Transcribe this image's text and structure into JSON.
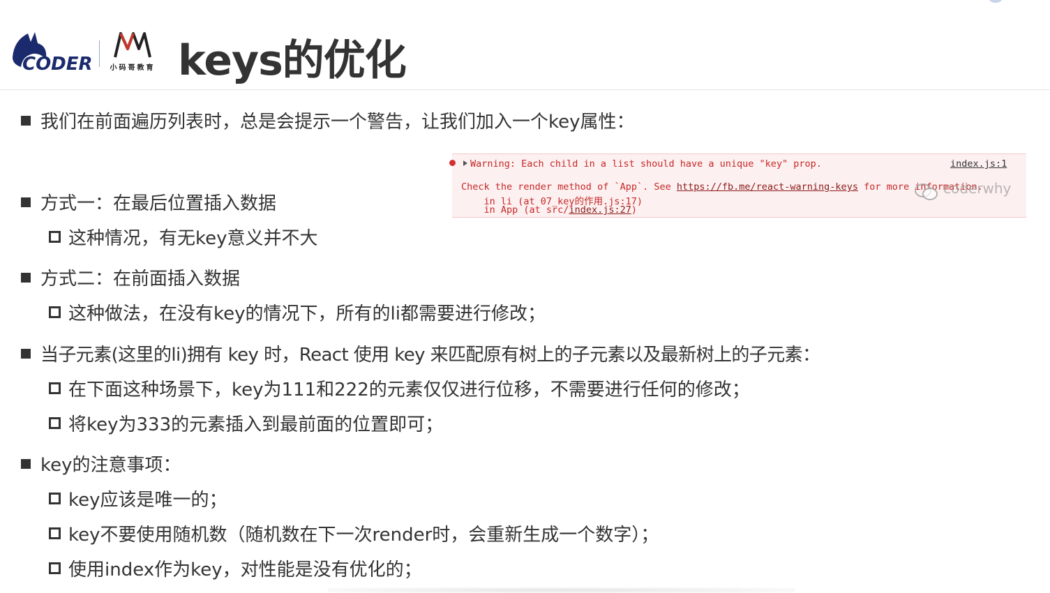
{
  "header": {
    "title": "keys的优化",
    "logo1_text": "CODER",
    "logo2_text": "小码哥教育",
    "brand_color": "#1a2a6c",
    "accent_color": "#c0392b"
  },
  "items": [
    {
      "level": 1,
      "text": "我们在前面遍历列表时，总是会提示一个警告，让我们加入一个key属性："
    },
    {
      "level": 1,
      "text": "方式一：在最后位置插入数据"
    },
    {
      "level": 2,
      "text": "这种情况，有无key意义并不大"
    },
    {
      "level": 1,
      "text": "方式二：在前面插入数据"
    },
    {
      "level": 2,
      "text": "这种做法，在没有key的情况下，所有的li都需要进行修改；"
    },
    {
      "level": 1,
      "text": "当子元素(这里的li)拥有 key 时，React 使用 key 来匹配原有树上的子元素以及最新树上的子元素："
    },
    {
      "level": 2,
      "text": "在下面这种场景下，key为111和222的元素仅仅进行位移，不需要进行任何的修改；"
    },
    {
      "level": 2,
      "text": "将key为333的元素插入到最前面的位置即可；"
    },
    {
      "level": 1,
      "text": "key的注意事项："
    },
    {
      "level": 2,
      "text": "key应该是唯一的；"
    },
    {
      "level": 2,
      "text": "key不要使用随机数（随机数在下一次render时，会重新生成一个数字）；"
    },
    {
      "level": 2,
      "text": "使用index作为key，对性能是没有优化的；"
    }
  ],
  "warning": {
    "line1": "Warning: Each child in a list should have a unique \"key\" prop.",
    "source": "index.js:1",
    "line2_prefix": "Check the render method of `App`. See ",
    "line2_link": "https://fb.me/react-warning-keys",
    "line2_suffix": " for more information.",
    "line3_prefix": "    in li (at ",
    "line3_file": "07_key的作用.js:17",
    "line3_suffix": ")",
    "line4_prefix": "    in App (at src/",
    "line4_file": "index.js:27",
    "line4_suffix": ")"
  },
  "watermark": {
    "text": "coderwhy",
    "icon": "wechat-icon"
  }
}
